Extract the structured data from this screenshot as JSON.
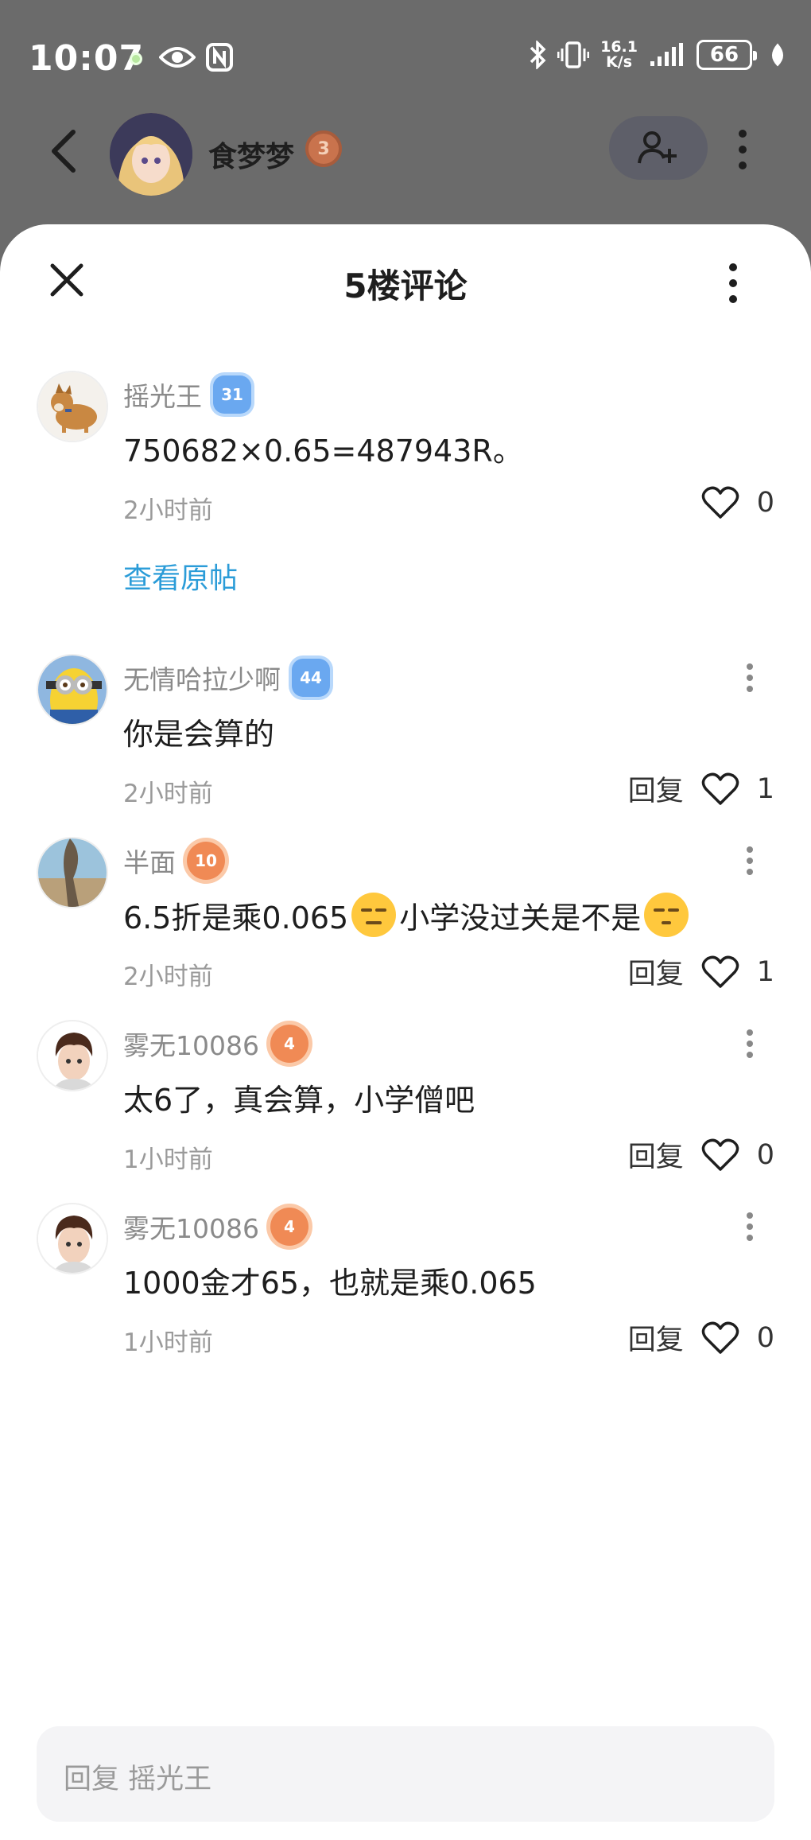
{
  "status_bar": {
    "time": "10:07",
    "net_speed_value": "16.1",
    "net_speed_unit": "K/s",
    "battery": "66"
  },
  "header": {
    "username": "食梦梦",
    "level": "3"
  },
  "sheet": {
    "title": "5楼评论"
  },
  "comments": [
    {
      "name": "摇光王",
      "level": "31",
      "badge_color": "#6aa8f0",
      "text": "750682×0.65=487943R。",
      "time": "2小时前",
      "likes": "0",
      "show_reply": false,
      "view_original": "查看原帖"
    },
    {
      "name": "无情哈拉少啊",
      "level": "44",
      "badge_color": "#6aa8f0",
      "text": "你是会算的",
      "time": "2小时前",
      "likes": "1",
      "reply": "回复"
    },
    {
      "name": "半面",
      "level": "10",
      "badge_color": "#f08a55",
      "text_before": "6.5折是乘0.065",
      "text_middle": "小学没过关是不是",
      "time": "2小时前",
      "likes": "1",
      "reply": "回复"
    },
    {
      "name": "雾无10086",
      "level": "4",
      "badge_color": "#f08a55",
      "text": "太6了，真会算，小学僧吧",
      "time": "1小时前",
      "likes": "0",
      "reply": "回复"
    },
    {
      "name": "雾无10086",
      "level": "4",
      "badge_color": "#f08a55",
      "text": "1000金才65，也就是乘0.065",
      "time": "1小时前",
      "likes": "0",
      "reply": "回复"
    }
  ],
  "reply_input": {
    "placeholder": "回复 摇光王"
  },
  "icons": [
    "eye-icon",
    "nfc-icon",
    "bluetooth-icon",
    "vibrate-icon",
    "signal-icon",
    "leaf-icon",
    "back-arrow-icon",
    "add-friend-icon",
    "more-vertical-icon",
    "close-icon",
    "heart-icon"
  ]
}
